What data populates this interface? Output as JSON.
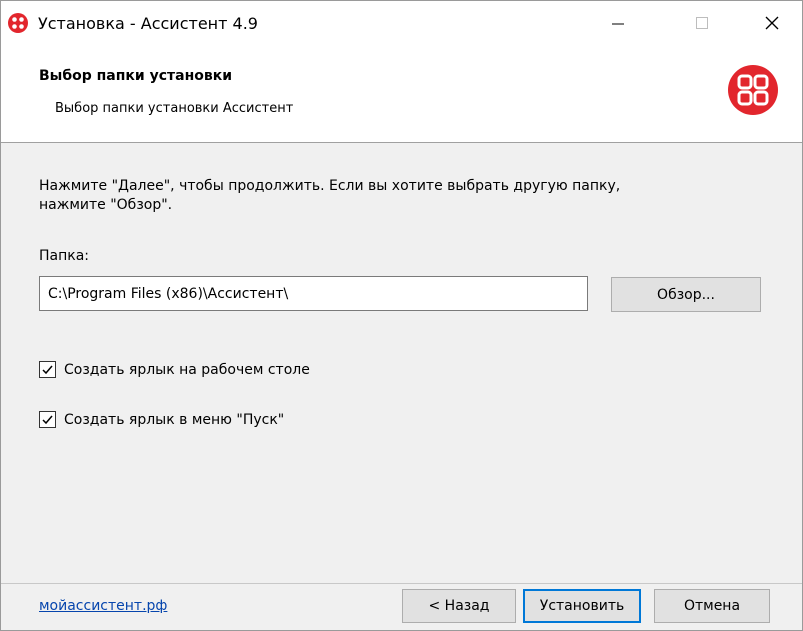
{
  "window": {
    "title": "Установка - Ассистент 4.9",
    "controls": {
      "minimize": "minimize-icon",
      "maximize": "maximize-icon",
      "close": "close-icon"
    }
  },
  "header": {
    "title": "Выбор папки установки",
    "subtitle": "Выбор папки установки Ассистент",
    "logo_icon": "assistant-logo-icon",
    "logo_color": "#e2262d"
  },
  "content": {
    "instruction": "Нажмите \"Далее\", чтобы продолжить. Если вы хотите выбрать другую папку,\nнажмите \"Обзор\".",
    "folder_label": "Папка:",
    "folder_path": "C:\\Program Files (x86)\\Ассистент\\",
    "browse_label": "Обзор...",
    "checkboxes": [
      {
        "label": "Создать ярлык на рабочем столе",
        "checked": true
      },
      {
        "label": "Создать ярлык в меню \"Пуск\"",
        "checked": true
      }
    ]
  },
  "footer": {
    "site_link": "мойассистент.рф",
    "back_label": "< Назад",
    "install_label": "Установить",
    "cancel_label": "Отмена",
    "link_color": "#0645ad",
    "focus_color": "#0078d7"
  }
}
